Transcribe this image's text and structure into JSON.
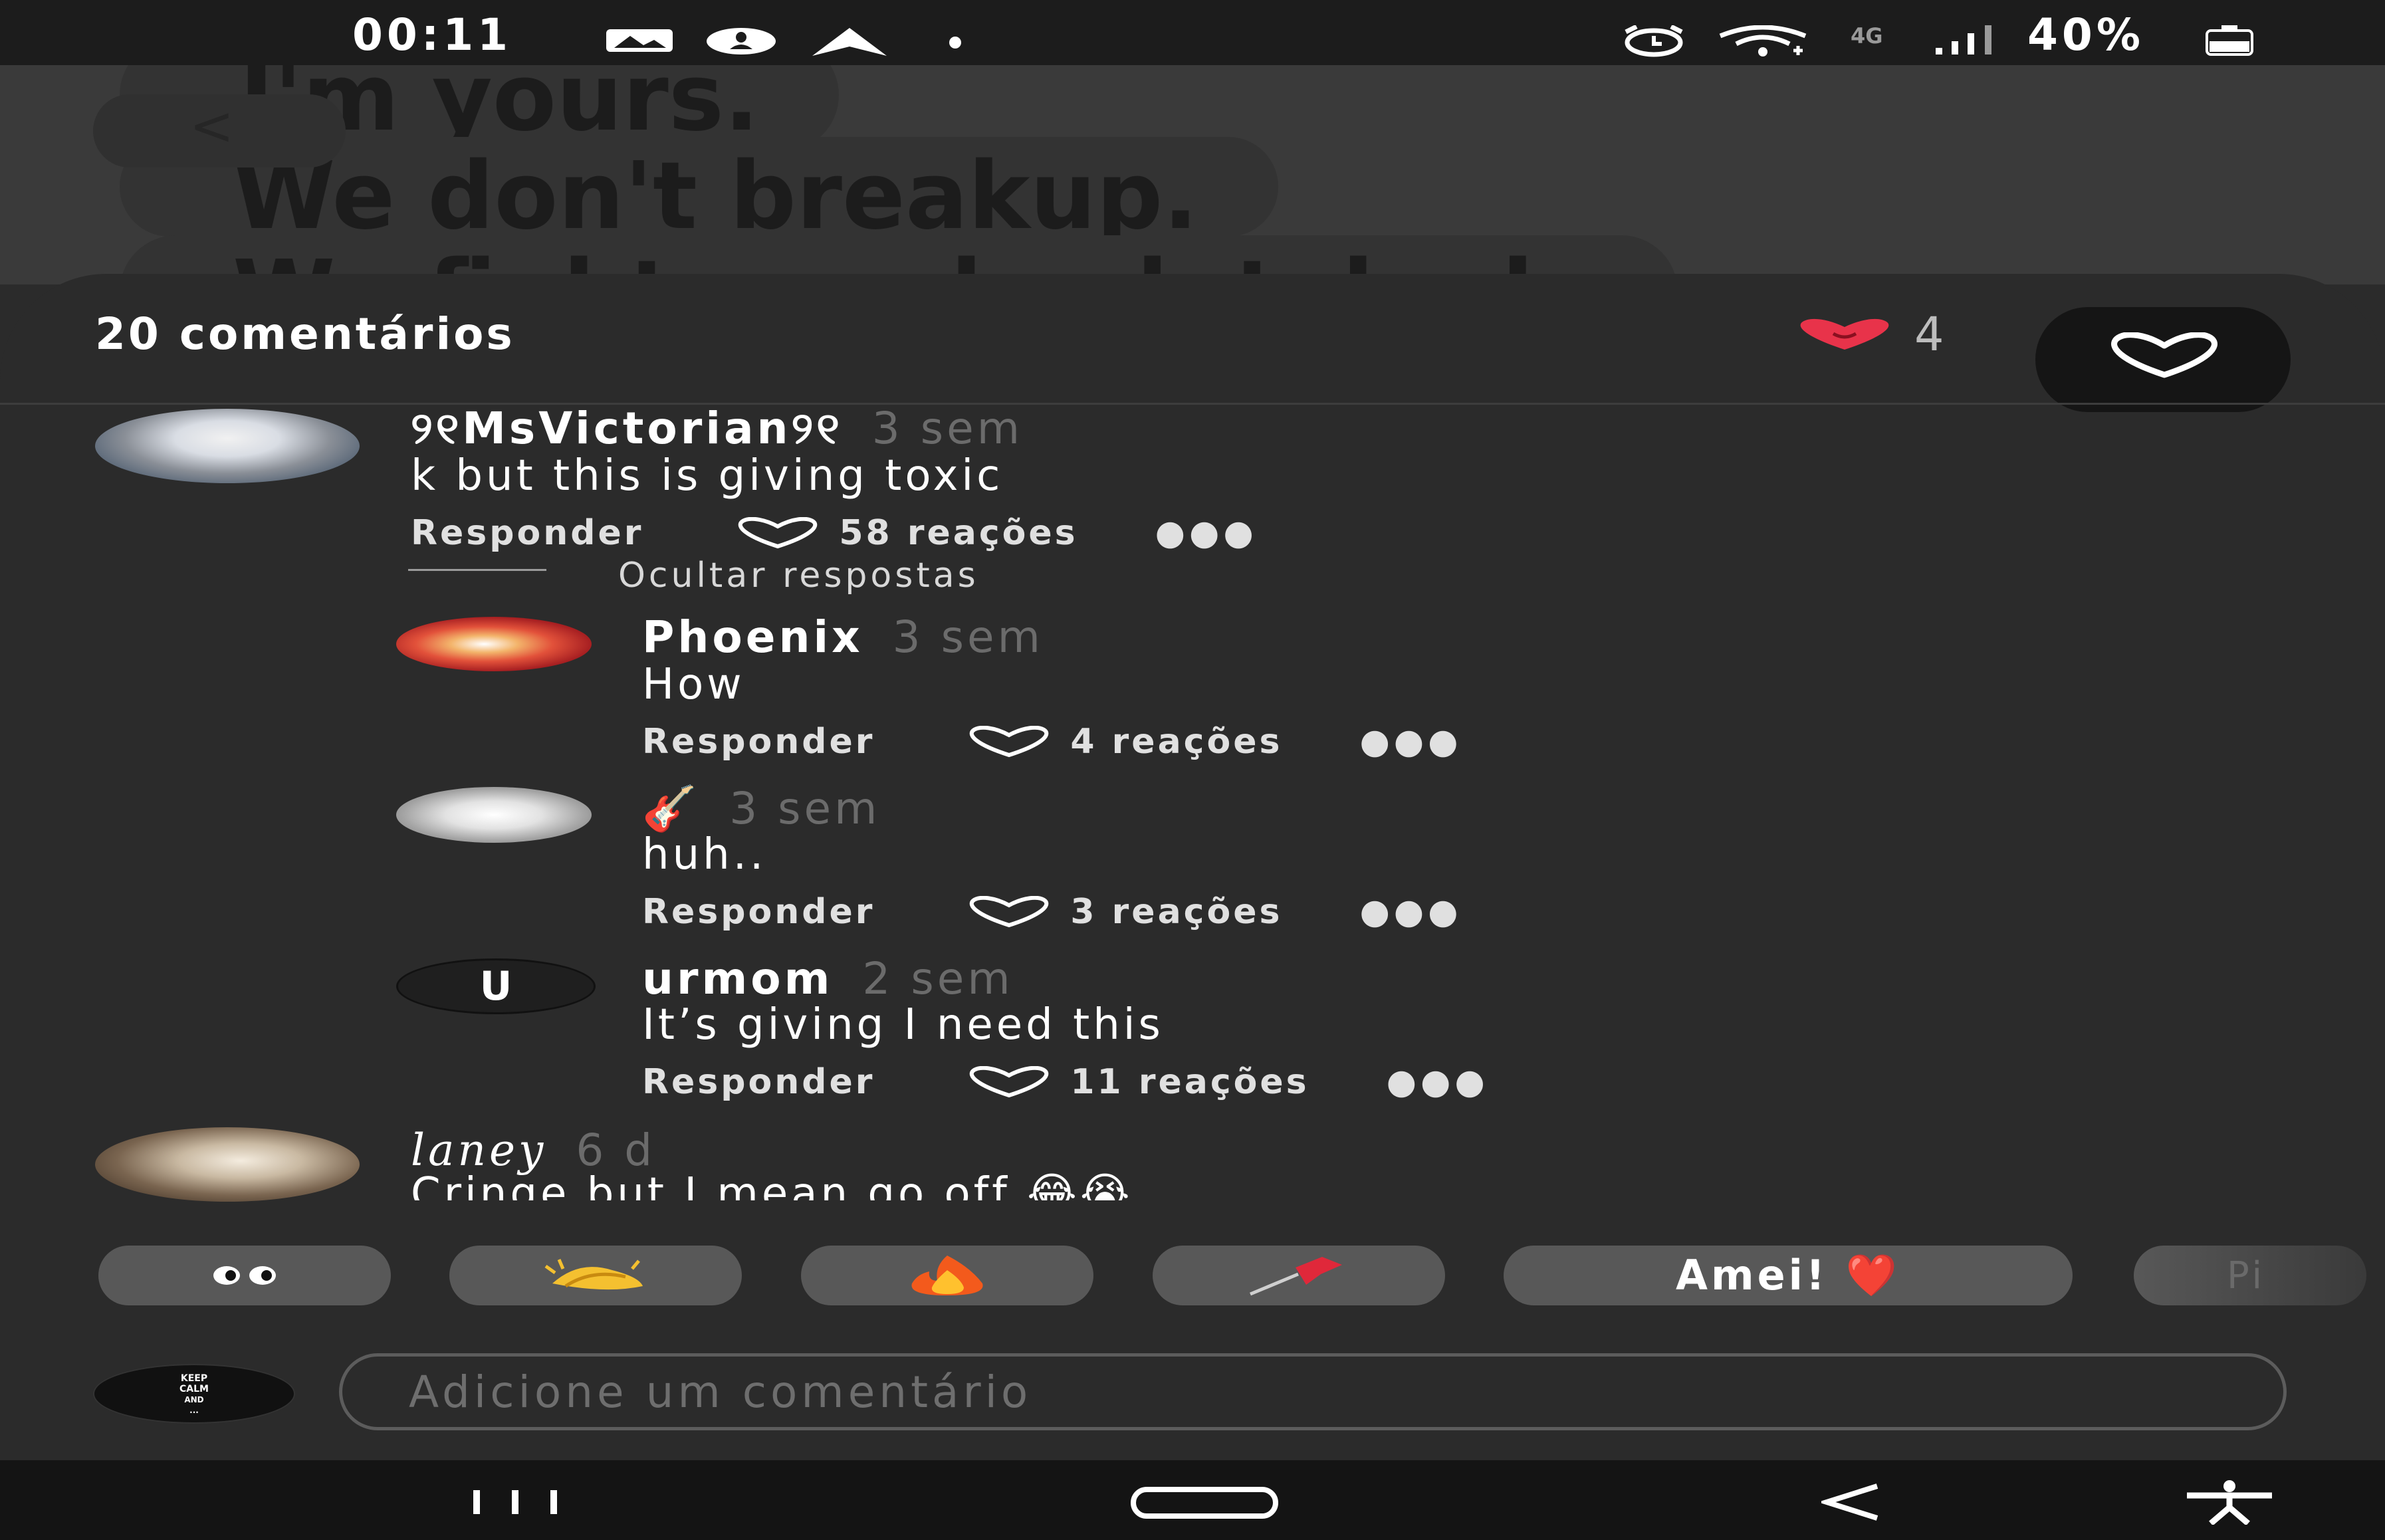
{
  "status_bar": {
    "time": "00:11",
    "network": "4G",
    "battery": "40%"
  },
  "story": {
    "lines": [
      "I'm yours.",
      "We don't breakup.",
      "We fight we absolutely do"
    ]
  },
  "comments_header": {
    "title": "20 comentários",
    "like_count": "4"
  },
  "comments": [
    {
      "username": "୨୧MsVictorian୨୧",
      "time": "3 sem",
      "text": "k but this is giving toxic",
      "reply_label": "Responder",
      "reactions": "58 reações",
      "hide_replies_label": "Ocultar respostas",
      "replies": [
        {
          "username": "Phoenix",
          "time": "3 sem",
          "text": "How",
          "reply_label": "Responder",
          "reactions": "4 reações"
        },
        {
          "username": "🎸",
          "time": "3 sem",
          "text": "huh..",
          "reply_label": "Responder",
          "reactions": "3 reações"
        },
        {
          "username": "urmom",
          "time": "2 sem",
          "text": "It’s giving I need this",
          "reply_label": "Responder",
          "reactions": "11 reações",
          "avatar_letter": "U"
        }
      ]
    },
    {
      "username": "laney",
      "time": "6 d",
      "text": "Cringe but I mean go off 😂😭"
    }
  ],
  "quick_reactions": [
    "👀",
    "👏",
    "🔥",
    "📌",
    "Amei! ❤️",
    "Pi"
  ],
  "comment_input": {
    "placeholder": "Adicione um comentário"
  },
  "my_avatar_text": "KEEP CALM AND ..."
}
